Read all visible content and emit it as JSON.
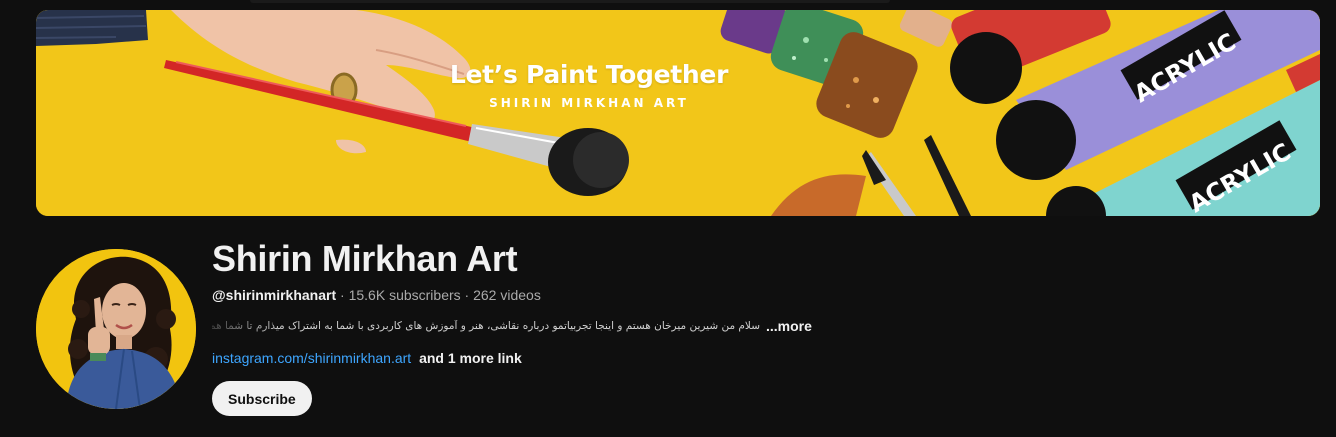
{
  "banner": {
    "title": "Let’s Paint Together",
    "subtitle": "SHIRIN MIRKHAN ART",
    "tube_label": "ACRYLIC",
    "colors": {
      "background": "#f2c619",
      "brush_handle": "#d32626",
      "tube_purple": "#9a8fd9",
      "tube_teal": "#7fd4cf"
    }
  },
  "channel": {
    "name": "Shirin Mirkhan Art",
    "handle": "@shirinmirkhanart",
    "separator": "·",
    "subscribers": "15.6K subscribers",
    "videos": "262 videos",
    "description": "سلام من شیرین میرخان هستم و اینجا تجربیاتمو درباره نقاشی، هنر و آموزش های کاربردی با شما به اشتراک میذارم تا شما هم بتونید امتحان کنید به",
    "more_label": "...more",
    "link_text": "instagram.com/shirinmirkhan.art",
    "more_links_label": "and 1 more link",
    "subscribe_label": "Subscribe"
  },
  "colors": {
    "page_bg": "#0f0f0f",
    "link": "#3ea6ff",
    "text": "#f1f1f1",
    "muted": "#aaaaaa"
  }
}
